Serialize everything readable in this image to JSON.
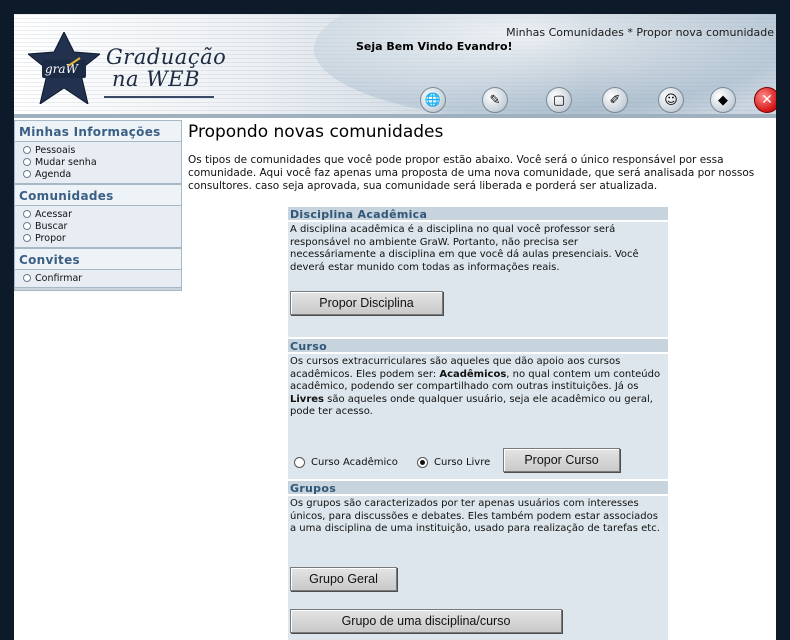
{
  "header": {
    "logo_text": "graW",
    "title_line1": "Graduação",
    "title_line2": "na WEB",
    "breadcrumb": "Minhas Comunidades * Propor nova comunidade",
    "welcome": "Seja Bem Vindo Evandro!",
    "toolbar_icons": [
      "globe-icon",
      "edit-pencil-icon",
      "document-icon",
      "tools-icon",
      "user-icon",
      "book-icon",
      "close-icon"
    ],
    "toolbar_glyphs": [
      "🌐",
      "✎",
      "▢",
      "✐",
      "☺",
      "◆",
      "✕"
    ]
  },
  "sidebar": {
    "sections": [
      {
        "title": "Minhas Informações",
        "items": [
          "Pessoais",
          "Mudar senha",
          "Agenda"
        ]
      },
      {
        "title": "Comunidades",
        "items": [
          "Acessar",
          "Buscar",
          "Propor"
        ]
      },
      {
        "title": "Convites",
        "items": [
          "Confirmar"
        ]
      }
    ]
  },
  "main": {
    "title": "Propondo novas comunidades",
    "intro": "Os tipos de comunidades que você pode propor estão abaixo. Você será o único responsável por essa comunidade. Aqui você faz apenas uma proposta de uma nova comunidade, que será analisada por nossos consultores. caso seja aprovada, sua comunidade será liberada e porderá ser atualizada.",
    "disciplina": {
      "heading": "Disciplina Acadêmica",
      "text": "A disciplina acadêmica é a disciplina no qual você professor será responsável no ambiente GraW. Portanto, não precisa ser necessáriamente a disciplina em que você dá aulas presenciais. Você deverá estar munido com todas as informações reais.",
      "button": "Propor Disciplina"
    },
    "curso": {
      "heading": "Curso",
      "text_before": "Os cursos extracurriculares são aqueles que dão apoio aos cursos acadêmicos. Eles podem ser: ",
      "bold1": "Acadêmicos",
      "text_middle": ", no qual contem um conteúdo acadêmico, podendo ser compartilhado com outras instituições. Já os ",
      "bold2": "Livres",
      "text_after": " são aqueles onde qualquer usuário, seja ele acadêmico ou geral, pode ter acesso.",
      "radio_academico": "Curso Acadêmico",
      "radio_livre": "Curso Livre",
      "selected": "Curso Livre",
      "button": "Propor Curso"
    },
    "grupos": {
      "heading": "Grupos",
      "text": "Os grupos são caracterizados por ter apenas usuários com interesses únicos, para discussões e debates. Eles também podem estar associados a uma disciplina de uma instituição, usado para realização de tarefas etc.",
      "button_geral": "Grupo Geral",
      "button_disciplina": "Grupo de uma disciplina/curso"
    }
  }
}
